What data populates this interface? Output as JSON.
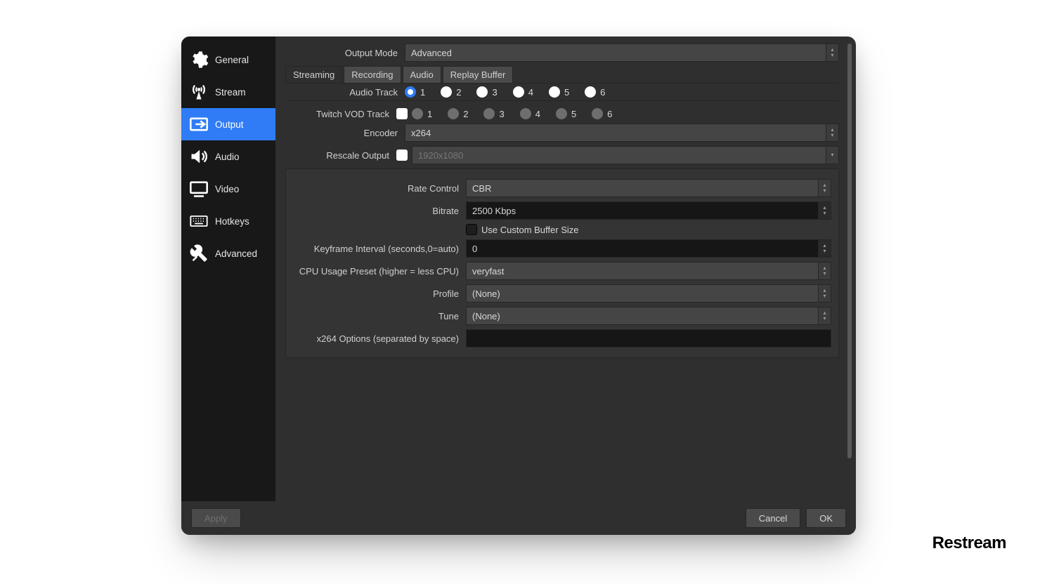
{
  "sidebar": [
    {
      "key": "general",
      "label": "General",
      "icon": "gear-icon",
      "active": false
    },
    {
      "key": "stream",
      "label": "Stream",
      "icon": "antenna-icon",
      "active": false
    },
    {
      "key": "output",
      "label": "Output",
      "icon": "output-icon",
      "active": true
    },
    {
      "key": "audio",
      "label": "Audio",
      "icon": "speaker-icon",
      "active": false
    },
    {
      "key": "video",
      "label": "Video",
      "icon": "monitor-icon",
      "active": false
    },
    {
      "key": "hotkeys",
      "label": "Hotkeys",
      "icon": "keyboard-icon",
      "active": false
    },
    {
      "key": "advanced",
      "label": "Advanced",
      "icon": "tools-icon",
      "active": false
    }
  ],
  "output_mode": {
    "label": "Output Mode",
    "value": "Advanced"
  },
  "tabs": {
    "streaming_label": "Streaming",
    "recording_label": "Recording",
    "audio_label": "Audio",
    "replay_buffer_label": "Replay Buffer",
    "active": "streaming"
  },
  "audio_track": {
    "label": "Audio Track",
    "options": [
      "1",
      "2",
      "3",
      "4",
      "5",
      "6"
    ],
    "selected": "1"
  },
  "twitch_vod": {
    "label": "Twitch VOD Track",
    "checked": false,
    "options": [
      "1",
      "2",
      "3",
      "4",
      "5",
      "6"
    ]
  },
  "encoder": {
    "label": "Encoder",
    "value": "x264"
  },
  "rescale": {
    "label": "Rescale Output",
    "checked": false,
    "value": "1920x1080"
  },
  "rate_control": {
    "label": "Rate Control",
    "value": "CBR"
  },
  "bitrate": {
    "label": "Bitrate",
    "value": "2500 Kbps"
  },
  "custom_buffer": {
    "label": "Use Custom Buffer Size",
    "checked": false
  },
  "keyframe": {
    "label": "Keyframe Interval (seconds,0=auto)",
    "value": "0"
  },
  "cpu_preset": {
    "label": "CPU Usage Preset (higher = less CPU)",
    "value": "veryfast"
  },
  "profile": {
    "label": "Profile",
    "value": "(None)"
  },
  "tune": {
    "label": "Tune",
    "value": "(None)"
  },
  "x264_opts": {
    "label": "x264 Options (separated by space)",
    "value": ""
  },
  "footer": {
    "apply": "Apply",
    "cancel": "Cancel",
    "ok": "OK"
  },
  "watermark": "Restream"
}
